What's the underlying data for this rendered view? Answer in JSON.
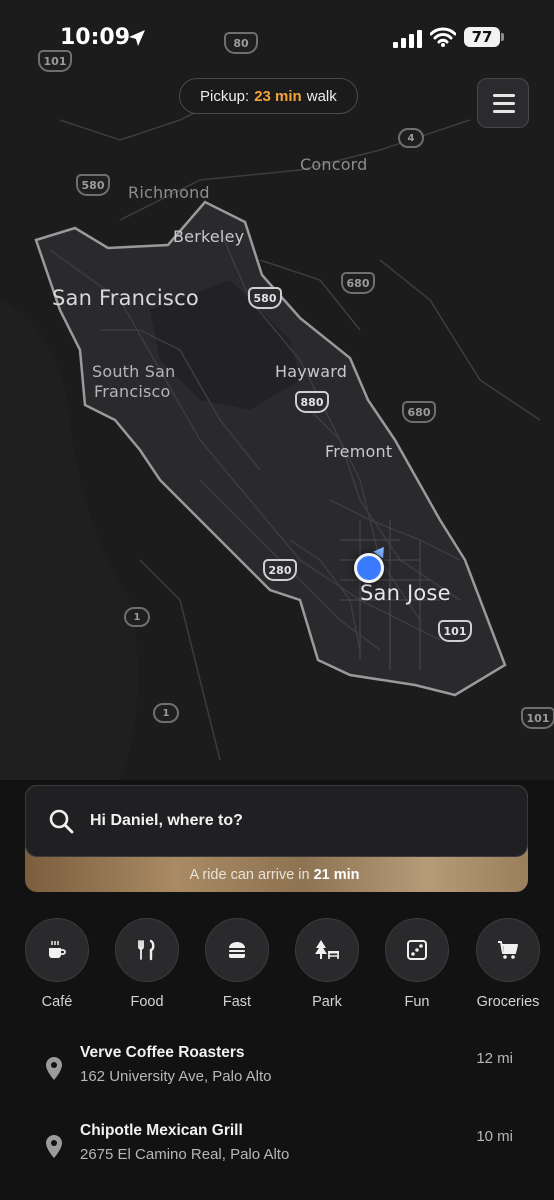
{
  "status_bar": {
    "time": "10:09",
    "battery": "77"
  },
  "pickup": {
    "prefix": "Pickup:",
    "minutes": "23 min",
    "suffix": "walk"
  },
  "map": {
    "cities": {
      "san_francisco": "San Francisco",
      "berkeley": "Berkeley",
      "richmond": "Richmond",
      "concord": "Concord",
      "south_sf_1": "South San",
      "south_sf_2": "Francisco",
      "hayward": "Hayward",
      "fremont": "Fremont",
      "san_jose": "San Jose"
    },
    "highways": {
      "h101a": "101",
      "h80": "80",
      "h4": "4",
      "h580a": "580",
      "h580b": "580",
      "h680a": "680",
      "h880": "880",
      "h680b": "680",
      "h280": "280",
      "h1a": "1",
      "h101b": "101",
      "h1b": "1",
      "h101c": "101"
    }
  },
  "search": {
    "placeholder": "Hi Daniel, where to?",
    "eta_prefix": "A ride can arrive in",
    "eta_value": "21 min"
  },
  "categories": [
    {
      "label": "Café",
      "icon": "coffee-icon"
    },
    {
      "label": "Food",
      "icon": "utensils-icon"
    },
    {
      "label": "Fast",
      "icon": "burger-icon"
    },
    {
      "label": "Park",
      "icon": "tree-bench-icon"
    },
    {
      "label": "Fun",
      "icon": "dice-icon"
    },
    {
      "label": "Groceries",
      "icon": "cart-icon"
    }
  ],
  "places": [
    {
      "name": "Verve Coffee Roasters",
      "address": "162 University Ave, Palo Alto",
      "distance": "12 mi"
    },
    {
      "name": "Chipotle Mexican Grill",
      "address": "2675 El Camino Real, Palo Alto",
      "distance": "10 mi"
    }
  ],
  "colors": {
    "accent": "#f1a33b",
    "location_dot": "#3a7bff",
    "eta_bar": "#a98a64"
  }
}
